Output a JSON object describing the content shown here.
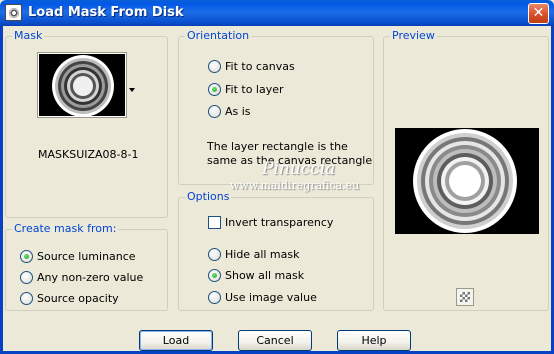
{
  "window": {
    "title": "Load Mask From Disk",
    "close_glyph": "✕"
  },
  "mask": {
    "label": "Mask",
    "name": "MASKSUIZA08-8-1"
  },
  "orientation": {
    "label": "Orientation",
    "options": [
      "Fit to canvas",
      "Fit to layer",
      "As is"
    ],
    "selected": "Fit to layer",
    "info": "The layer rectangle is the same as the canvas rectangle"
  },
  "preview": {
    "label": "Preview"
  },
  "create_from": {
    "label": "Create mask from:",
    "options": [
      "Source luminance",
      "Any non-zero value",
      "Source opacity"
    ],
    "selected": "Source luminance"
  },
  "options": {
    "label": "Options",
    "invert_label": "Invert transparency",
    "invert_checked": false,
    "visibility_options": [
      "Hide all mask",
      "Show all mask",
      "Use image value"
    ],
    "visibility_selected": "Show all mask"
  },
  "buttons": {
    "load": "Load",
    "cancel": "Cancel",
    "help": "Help"
  },
  "watermark": {
    "line1": "Pinuccia",
    "line2": "www.maidiregrafica.eu"
  }
}
